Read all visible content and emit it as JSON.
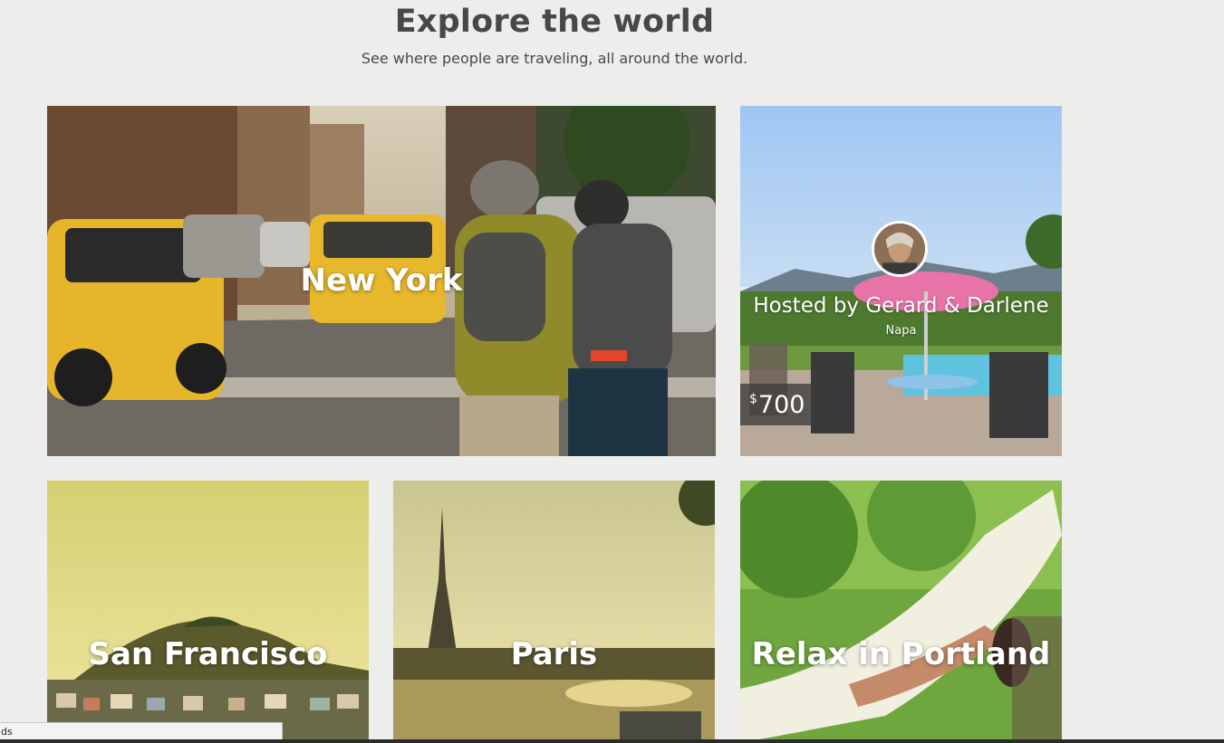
{
  "header": {
    "title": "Explore the world",
    "subtitle": "See where people are traveling, all around the world."
  },
  "cards": {
    "new_york": {
      "label": "New York"
    },
    "napa": {
      "host_label": "Hosted by Gerard & Darlene",
      "location": "Napa",
      "currency": "$",
      "price": "700"
    },
    "san_francisco": {
      "label": "San Francisco"
    },
    "paris": {
      "label": "Paris"
    },
    "portland": {
      "label": "Relax in Portland"
    }
  },
  "status_bar": {
    "text": "ds"
  },
  "colors": {
    "background": "#edeeeb",
    "heading": "#484848",
    "price_tag_bg": "#3c3c3c"
  }
}
